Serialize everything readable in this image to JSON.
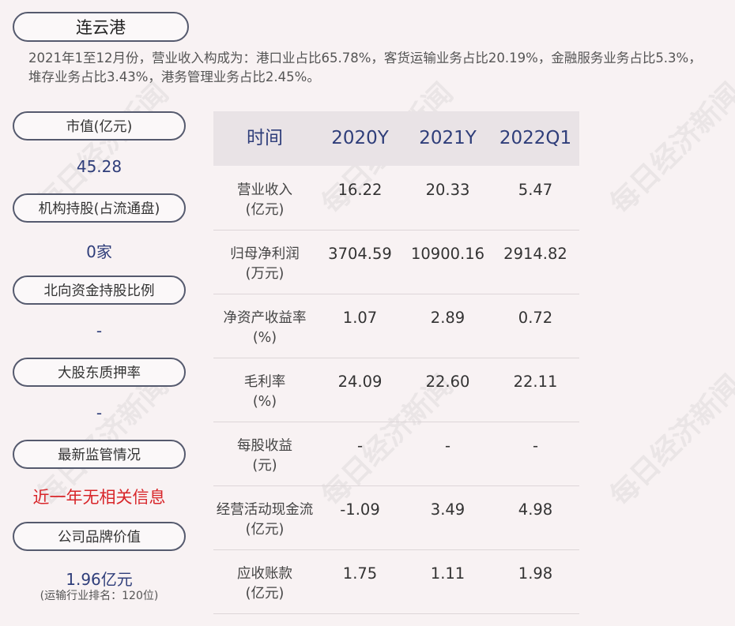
{
  "company": "连云港",
  "summary": "2021年1至12月份，营业收入构成为：港口业占比65.78%，客货运输业务占比20.19%，金融服务业务占比5.3%，堆存业务占比3.43%，港务管理业务占比2.45%。",
  "sidebar": {
    "market_cap_label": "市值(亿元)",
    "market_cap_value": "45.28",
    "institution_label": "机构持股(占流通盘)",
    "institution_value": "0家",
    "northbound_label": "北向资金持股比例",
    "northbound_value": "-",
    "pledge_label": "大股东质押率",
    "pledge_value": "-",
    "regulation_label": "最新监管情况",
    "regulation_value": "近一年无相关信息",
    "brand_label": "公司品牌价值",
    "brand_value": "1.96亿元",
    "brand_note": "(运输行业排名：120位)"
  },
  "table": {
    "headers": [
      "时间",
      "2020Y",
      "2021Y",
      "2022Q1"
    ],
    "rows": [
      {
        "label1": "营业收入",
        "label2": "(亿元)",
        "values": [
          "16.22",
          "20.33",
          "5.47"
        ]
      },
      {
        "label1": "归母净利润",
        "label2": "(万元)",
        "values": [
          "3704.59",
          "10900.16",
          "2914.82"
        ]
      },
      {
        "label1": "净资产收益率",
        "label2": "(%)",
        "values": [
          "1.07",
          "2.89",
          "0.72"
        ]
      },
      {
        "label1": "毛利率",
        "label2": "(%)",
        "values": [
          "24.09",
          "22.60",
          "22.11"
        ]
      },
      {
        "label1": "每股收益",
        "label2": "(元)",
        "values": [
          "-",
          "-",
          "-"
        ]
      },
      {
        "label1": "经营活动现金流",
        "label2": "(亿元)",
        "values": [
          "-1.09",
          "3.49",
          "4.98"
        ]
      },
      {
        "label1": "应收账款",
        "label2": "(亿元)",
        "values": [
          "1.75",
          "1.11",
          "1.98"
        ]
      }
    ]
  },
  "watermark": "每日经济新闻"
}
